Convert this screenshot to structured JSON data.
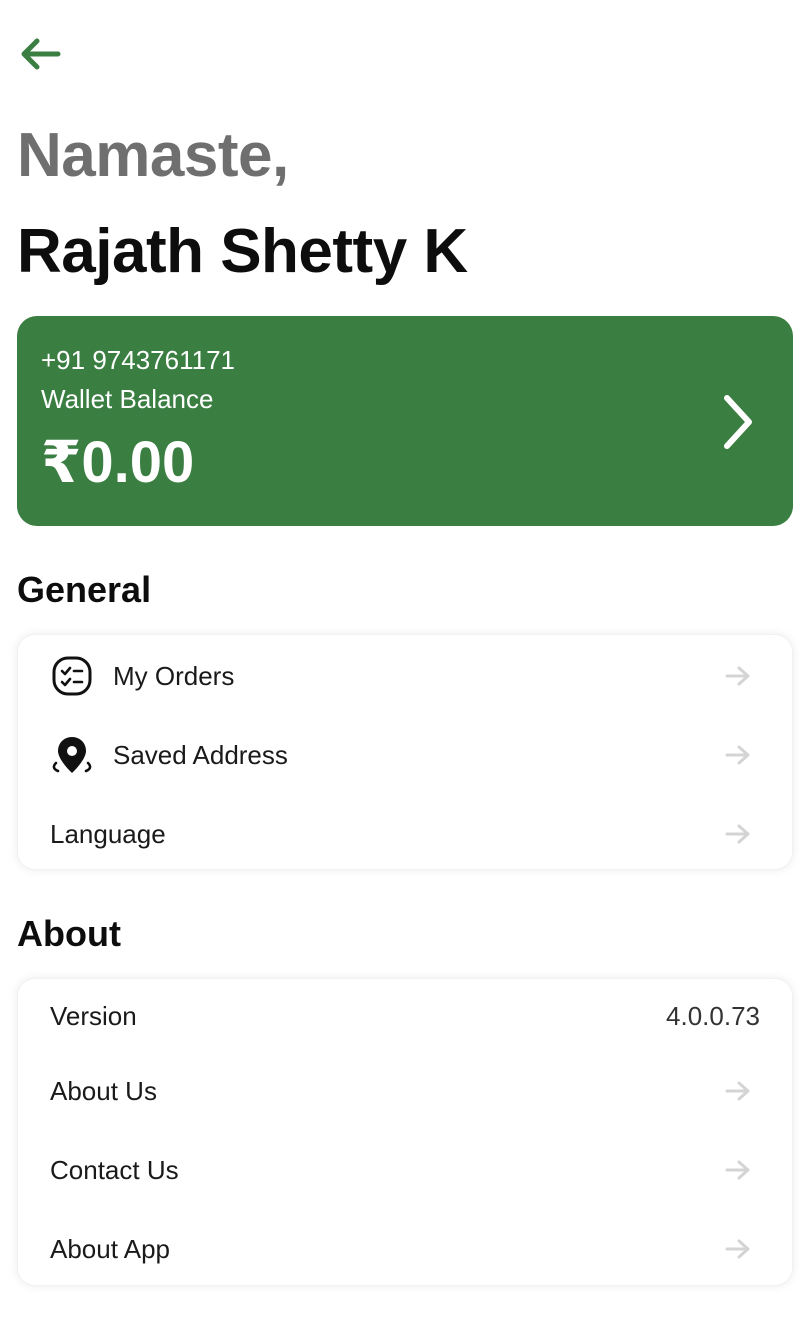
{
  "header": {
    "greeting": "Namaste,",
    "user_name": "Rajath Shetty K"
  },
  "wallet": {
    "phone": "+91 9743761171",
    "label": "Wallet Balance",
    "amount": "₹0.00"
  },
  "general": {
    "title": "General",
    "items": [
      {
        "label": "My Orders",
        "icon": "orders-checklist-icon"
      },
      {
        "label": "Saved Address",
        "icon": "location-pin-icon"
      },
      {
        "label": "Language",
        "icon": ""
      }
    ]
  },
  "about": {
    "title": "About",
    "version_label": "Version",
    "version_value": "4.0.0.73",
    "items": [
      {
        "label": "About Us"
      },
      {
        "label": "Contact Us"
      },
      {
        "label": "About App"
      }
    ]
  },
  "colors": {
    "accent": "#3a7e42",
    "greeting_gray": "#6f6f6f",
    "arrow_gray": "#d4d4d4"
  }
}
